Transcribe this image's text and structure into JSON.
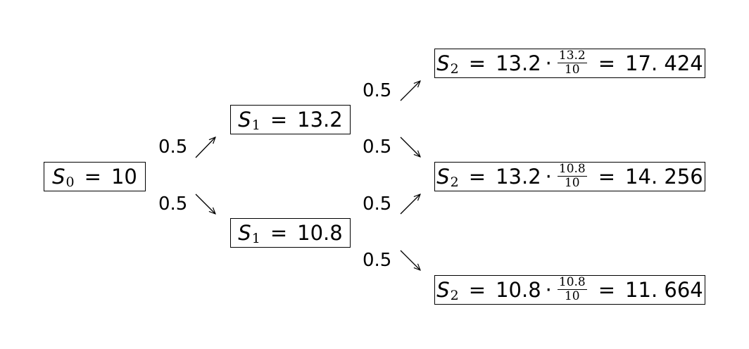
{
  "nodes": {
    "s0": {
      "var": "S",
      "sub": "0",
      "eq": "=",
      "value": "10"
    },
    "s1_up": {
      "var": "S",
      "sub": "1",
      "eq": "=",
      "value": "13.2"
    },
    "s1_down": {
      "var": "S",
      "sub": "1",
      "eq": "=",
      "value": "10.8"
    },
    "s2_uu": {
      "var": "S",
      "sub": "2",
      "eq": "=",
      "lhs": "13.2",
      "dot": "·",
      "num": "13.2",
      "den": "10",
      "eq2": "=",
      "result": "17. 424"
    },
    "s2_ud": {
      "var": "S",
      "sub": "2",
      "eq": "=",
      "lhs": "13.2",
      "dot": "·",
      "num": "10.8",
      "den": "10",
      "eq2": "=",
      "result": "14. 256"
    },
    "s2_dd": {
      "var": "S",
      "sub": "2",
      "eq": "=",
      "lhs": "10.8",
      "dot": "·",
      "num": "10.8",
      "den": "10",
      "eq2": "=",
      "result": "11. 664"
    }
  },
  "edges": {
    "s0_up": {
      "prob": "0.5"
    },
    "s0_down": {
      "prob": "0.5"
    },
    "s1u_up": {
      "prob": "0.5"
    },
    "s1u_down": {
      "prob": "0.5"
    },
    "s1d_up": {
      "prob": "0.5"
    },
    "s1d_down": {
      "prob": "0.5"
    }
  }
}
